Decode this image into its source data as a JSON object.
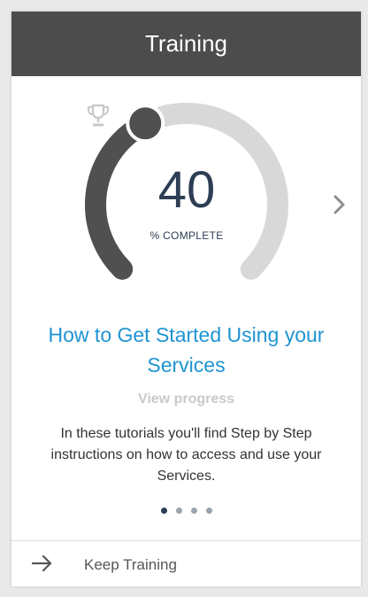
{
  "header": {
    "title": "Training"
  },
  "progress": {
    "value": "40",
    "percent": 40,
    "caption": "% COMPLETE",
    "colors": {
      "filled": "#505050",
      "track": "#d8d8d8",
      "value_text": "#2d3e55"
    }
  },
  "course": {
    "title": "How to Get Started Using your Services",
    "view_progress_label": "View progress",
    "description": "In these tutorials you'll find Step by Step instructions on how to access and use your Services."
  },
  "carousel": {
    "total": 4,
    "active_index": 0
  },
  "footer": {
    "label": "Keep Training"
  },
  "icons": {
    "next": "chevron-right-icon",
    "trophy": "trophy-icon",
    "keep_training": "arrow-right-icon"
  },
  "colors": {
    "header_bg": "#4c4c4c",
    "title_link": "#1f94d2",
    "muted": "#c9c9c9"
  }
}
